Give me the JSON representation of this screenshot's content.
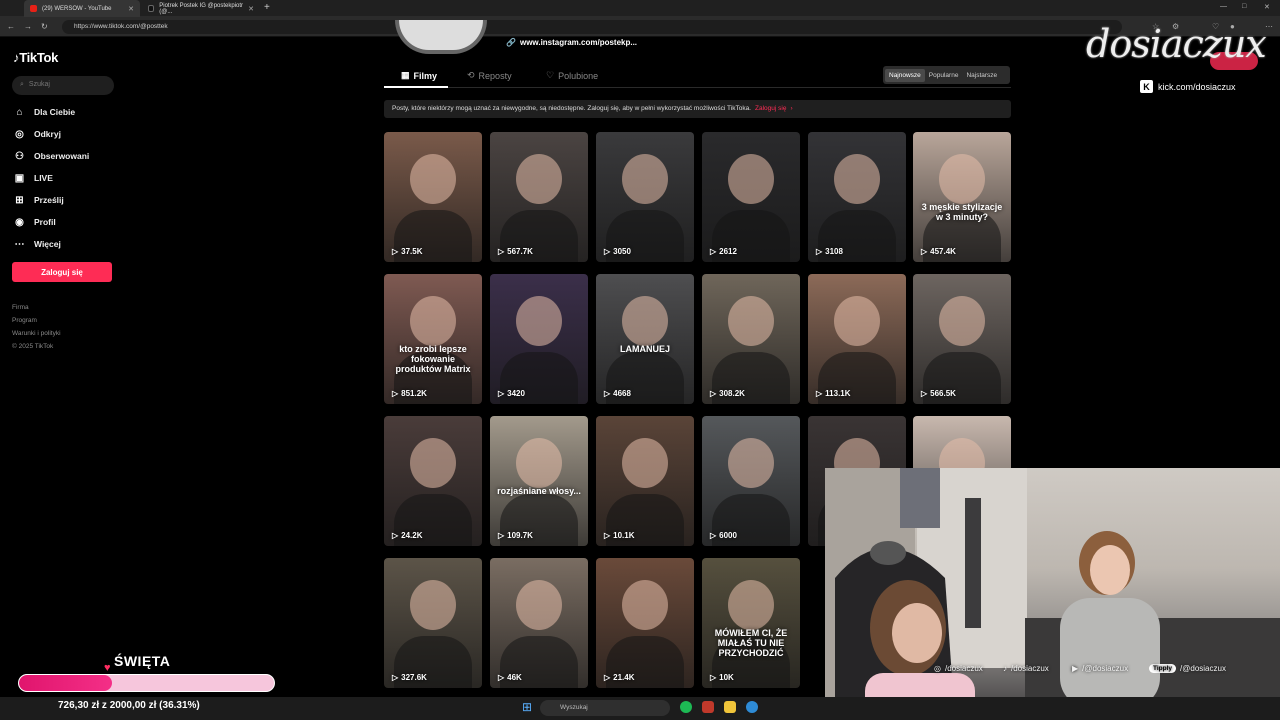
{
  "browser": {
    "tabs": [
      {
        "label": "(29) WERSOW - YouTube"
      },
      {
        "label": "Piotrek Postek IG @postekpiotr (@..."
      }
    ],
    "url": "https://www.tiktok.com/@posttek"
  },
  "sidebar": {
    "logo": "TikTok",
    "search_placeholder": "Szukaj",
    "items": [
      {
        "label": "Dla Ciebie",
        "icon": "home-icon"
      },
      {
        "label": "Odkryj",
        "icon": "compass-icon"
      },
      {
        "label": "Obserwowani",
        "icon": "following-icon"
      },
      {
        "label": "LIVE",
        "icon": "live-icon"
      },
      {
        "label": "Prześlij",
        "icon": "upload-icon"
      },
      {
        "label": "Profil",
        "icon": "profile-icon"
      },
      {
        "label": "Więcej",
        "icon": "more-icon"
      }
    ],
    "login_label": "Zaloguj się",
    "footer": [
      "Firma",
      "Program",
      "Warunki i polityki",
      "© 2025 TikTok"
    ]
  },
  "profile": {
    "link": "www.instagram.com/postekp...",
    "tabs": [
      {
        "label": "Filmy",
        "icon": "grid-icon"
      },
      {
        "label": "Reposty",
        "icon": "repost-icon"
      },
      {
        "label": "Polubione",
        "icon": "heart-icon"
      }
    ],
    "sort": [
      "Najnowsze",
      "Popularne",
      "Najstarsze"
    ],
    "notice": "Posty, które niektórzy mogą uznać za niewygodne, są niedostępne. Zaloguj się, aby w pełni wykorzystać możliwości TikToka.",
    "notice_link": "Zaloguj się"
  },
  "videos": [
    {
      "views": "37.5K",
      "color": "#7a5a4a",
      "caption": ""
    },
    {
      "views": "567.7K",
      "color": "#4b4442",
      "caption": ""
    },
    {
      "views": "3050",
      "color": "#3a3a3c",
      "caption": ""
    },
    {
      "views": "2612",
      "color": "#2a2a2c",
      "caption": ""
    },
    {
      "views": "3108",
      "color": "#333336",
      "caption": ""
    },
    {
      "views": "457.4K",
      "color": "#b9a69a",
      "caption": "3 męskie stylizacje w 3 minuty?"
    },
    {
      "views": "851.2K",
      "color": "#7f5a52",
      "caption": "kto zrobi lepsze fokowanie produktów Matrix"
    },
    {
      "views": "3420",
      "color": "#3b2f4a",
      "caption": ""
    },
    {
      "views": "4668",
      "color": "#4e4e50",
      "caption": "LAMANUEJ"
    },
    {
      "views": "308.2K",
      "color": "#6f665a",
      "caption": ""
    },
    {
      "views": "113.1K",
      "color": "#8c6a58",
      "caption": ""
    },
    {
      "views": "566.5K",
      "color": "#6d6560",
      "caption": ""
    },
    {
      "views": "24.2K",
      "color": "#4a3c3a",
      "caption": ""
    },
    {
      "views": "109.7K",
      "color": "#a39a8c",
      "caption": "rozjaśniane włosy..."
    },
    {
      "views": "10.1K",
      "color": "#5a4438",
      "caption": ""
    },
    {
      "views": "6000",
      "color": "#55585b",
      "caption": ""
    },
    {
      "views": "",
      "color": "#3a3434",
      "caption": ""
    },
    {
      "views": "",
      "color": "#c8b8ae",
      "caption": ""
    },
    {
      "views": "327.6K",
      "color": "#5c5448",
      "caption": ""
    },
    {
      "views": "46K",
      "color": "#7a6d62",
      "caption": ""
    },
    {
      "views": "21.4K",
      "color": "#6a4a3a",
      "caption": ""
    },
    {
      "views": "10K",
      "color": "#56503e",
      "caption": "MÓWIŁEM CI, ŻE MIAŁAŚ TU NIE PRZYCHODZIĆ"
    }
  ],
  "overlay": {
    "brand": "dosiaczux",
    "kick": "kick.com/dosiaczux",
    "socials": [
      {
        "icon": "instagram-icon",
        "label": "/dosiaczux"
      },
      {
        "icon": "tiktok-icon",
        "label": "/dosiaczux"
      },
      {
        "icon": "youtube-icon",
        "label": "/@dosiaczux"
      },
      {
        "icon": "tipply-icon",
        "badge": "Tipply",
        "label": "/@dosiaczux"
      }
    ],
    "goal": {
      "title": "ŚWIĘTA",
      "text": "726,30 zł z 2000,00 zł (36.31%)",
      "progress": 0.3631
    }
  },
  "taskbar": {
    "search": "Wyszukaj"
  },
  "colors": {
    "accent": "#fe2c55",
    "goal": "#e0156d"
  }
}
